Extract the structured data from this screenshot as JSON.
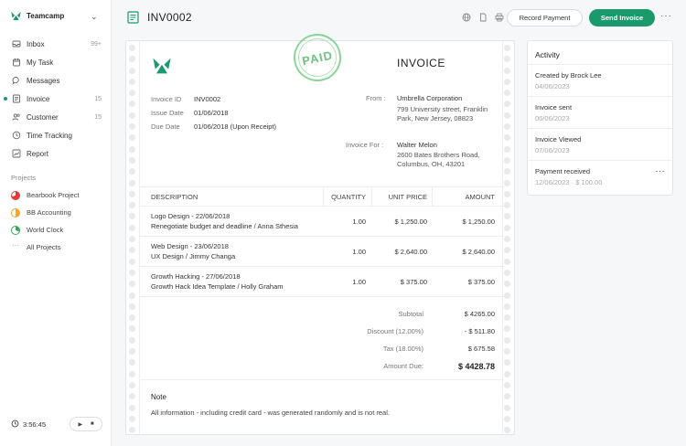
{
  "app": {
    "name": "Teamcamp"
  },
  "nav": [
    {
      "label": "Inbox",
      "count": "99+",
      "icon": "inbox-icon"
    },
    {
      "label": "My Task",
      "count": "",
      "icon": "calendar-icon"
    },
    {
      "label": "Messages",
      "count": "",
      "icon": "chat-icon"
    },
    {
      "label": "Invoice",
      "count": "15",
      "icon": "invoice-icon",
      "active": true
    },
    {
      "label": "Customer",
      "count": "15",
      "icon": "users-icon"
    },
    {
      "label": "Time Tracking",
      "count": "",
      "icon": "clock-icon"
    },
    {
      "label": "Report",
      "count": "",
      "icon": "chart-icon"
    }
  ],
  "projects": {
    "heading": "Projects",
    "items": [
      {
        "label": "Bearbook Project",
        "color": "#e53935"
      },
      {
        "label": "BB Accounting",
        "color": "#f5a623"
      },
      {
        "label": "World Clock",
        "color": "#3aa757"
      },
      {
        "label": "All Projects",
        "color": ""
      }
    ]
  },
  "timer": {
    "value": "3:56:45"
  },
  "header": {
    "title": "INV0002",
    "record_label": "Record Payment",
    "send_label": "Send Invoice"
  },
  "invoice": {
    "stamp": "PAID",
    "heading": "INVOICE",
    "meta": [
      {
        "k": "Invoice ID",
        "v": "INV0002"
      },
      {
        "k": "Issue Date",
        "v": "01/06/2018"
      },
      {
        "k": "Due Date",
        "v": "01/06/2018 (Upon Receipt)"
      }
    ],
    "from_label": "From :",
    "from_name": "Umbrella Corporation",
    "from_address": "799 University street, Franklin Park, New Jersey, 08823",
    "for_label": "Invoice For :",
    "for_name": "Walter Melon",
    "for_address": "2600 Bates Brothers Road, Columbus, OH, 43201",
    "columns": [
      "DESCRIPTION",
      "QUANTITY",
      "UNIT PRICE",
      "AMOUNT"
    ],
    "rows": [
      {
        "title": "Logo Design - 22/06/2018",
        "sub": "Renegotiate budget and deadline / Anna Sthesia",
        "qty": "1.00",
        "price": "$ 1,250.00",
        "amount": "$ 1,250.00"
      },
      {
        "title": "Web Design - 23/06/2018",
        "sub": "UX Design / Jimmy Changa",
        "qty": "1.00",
        "price": "$ 2,640.00",
        "amount": "$ 2,640.00"
      },
      {
        "title": "Growth Hacking - 27/06/2018",
        "sub": "Growth Hack Idea Template / Holly Graham",
        "qty": "1.00",
        "price": "$ 375.00",
        "amount": "$ 375.00"
      }
    ],
    "totals": [
      {
        "k": "Subtotal",
        "v": "$ 4265.00"
      },
      {
        "k": "Discount (12.00%)",
        "v": "- $ 511.80"
      },
      {
        "k": "Tax (18.00%)",
        "v": "$ 675.58"
      },
      {
        "k": "Amount Due:",
        "v": "$ 4428.78"
      }
    ],
    "note_title": "Note",
    "note_text": "All information - including credit card - was generated randomly and is not real."
  },
  "activity": {
    "title": "Activity",
    "items": [
      {
        "title": "Created by Brock Lee",
        "date": "04/06/2023"
      },
      {
        "title": "Invoice sent",
        "date": "06/06/2023"
      },
      {
        "title": "Invoice Viewed",
        "date": "07/06/2023"
      },
      {
        "title": "Payment received",
        "date": "12/06/2023 · $ 100.00"
      }
    ]
  },
  "colors": {
    "accent": "#1a9a6c",
    "stamp": "#5fbf72"
  }
}
